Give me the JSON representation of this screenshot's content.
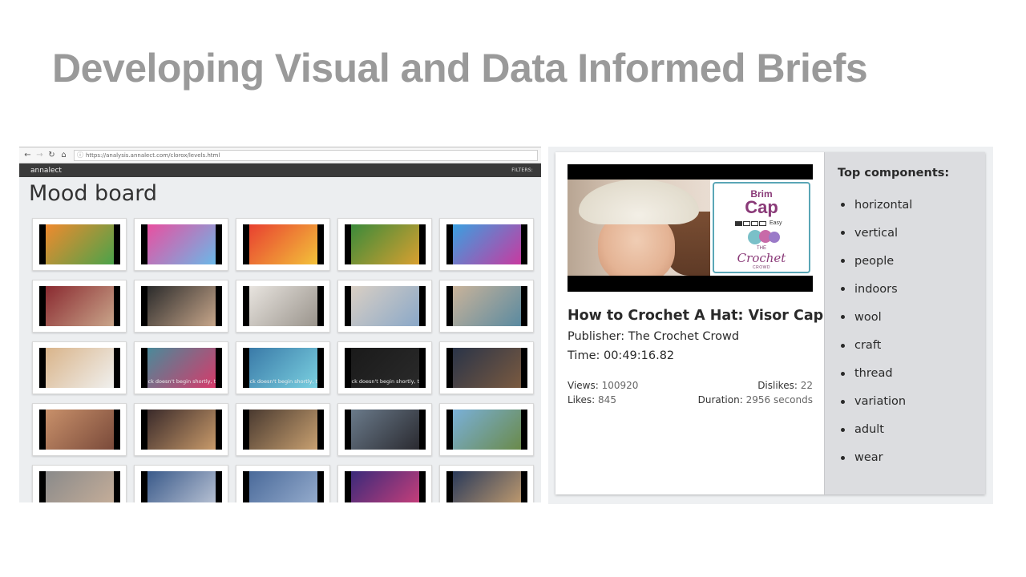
{
  "slide": {
    "title": "Developing Visual and Data Informed Briefs"
  },
  "browser": {
    "url": "https://analysis.annalect.com/clorox/levels.html",
    "brand": "annalect",
    "filters_label": "FILTERS:",
    "page_title": "Mood board",
    "nav_icons": [
      "back-icon",
      "forward-icon",
      "reload-icon",
      "home-icon"
    ]
  },
  "mood_board": {
    "overlay_text": "ck doesn't begin shortly, try r",
    "thumbnails": [
      {
        "c1": "#f08a2e",
        "c2": "#4aa34a"
      },
      {
        "c1": "#e94fa0",
        "c2": "#6ab8e8"
      },
      {
        "c1": "#e84030",
        "c2": "#f3c23a"
      },
      {
        "c1": "#3b8a3a",
        "c2": "#d9a030"
      },
      {
        "c1": "#3aa0e0",
        "c2": "#c83aa0"
      },
      {
        "c1": "#8a2a30",
        "c2": "#c9a58a"
      },
      {
        "c1": "#2b2b2b",
        "c2": "#c7a68a"
      },
      {
        "c1": "#e8e4df",
        "c2": "#9a948c"
      },
      {
        "c1": "#d9cfc4",
        "c2": "#8aa8c8"
      },
      {
        "c1": "#c9b39a",
        "c2": "#5a8aa0"
      },
      {
        "c1": "#d9b48a",
        "c2": "#f0f0ee"
      },
      {
        "c1": "#4a8a9a",
        "c2": "#d63a6a",
        "overlay": true
      },
      {
        "c1": "#3a7aa8",
        "c2": "#7ad0e0",
        "overlay": true
      },
      {
        "c1": "#1a1a1a",
        "c2": "#2a2a2a",
        "overlay": true
      },
      {
        "c1": "#2a3448",
        "c2": "#7a5a40"
      },
      {
        "c1": "#c8906a",
        "c2": "#7a4a3a"
      },
      {
        "c1": "#3a2a2a",
        "c2": "#c89a6a"
      },
      {
        "c1": "#4a3a30",
        "c2": "#c8a070"
      },
      {
        "c1": "#6a7a8a",
        "c2": "#2a2a30"
      },
      {
        "c1": "#7ab0d8",
        "c2": "#6a8a4a"
      },
      {
        "c1": "#8a8a8a",
        "c2": "#c9b09a"
      },
      {
        "c1": "#3a5a8a",
        "c2": "#c0c8d8"
      },
      {
        "c1": "#4a6a9a",
        "c2": "#9ab0d0"
      },
      {
        "c1": "#3a2a7a",
        "c2": "#d0407a"
      },
      {
        "c1": "#2a3a5a",
        "c2": "#c8a070"
      }
    ]
  },
  "video": {
    "logo": {
      "line1": "Brim",
      "line2": "Cap",
      "difficulty": "Easy",
      "the": "THE",
      "crochet": "Crochet",
      "crowd": "CROWD"
    },
    "title": "How to Crochet A Hat: Visor Cap",
    "publisher": "Publisher: The Crochet Crowd",
    "time": "Time: 00:49:16.82",
    "views_label": "Views:",
    "views": "100920",
    "dislikes_label": "Dislikes:",
    "dislikes": "22",
    "likes_label": "Likes:",
    "likes": "845",
    "duration_label": "Duration:",
    "duration": "2956 seconds"
  },
  "components": {
    "title": "Top components:",
    "items": [
      "horizontal",
      "vertical",
      "people",
      "indoors",
      "wool",
      "craft",
      "thread",
      "variation",
      "adult",
      "wear"
    ]
  }
}
